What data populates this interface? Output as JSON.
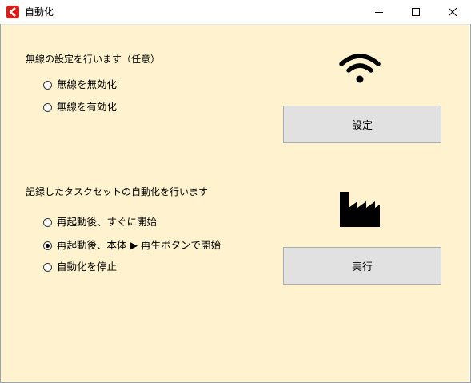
{
  "window": {
    "title": "自動化",
    "app_icon": "app-logo-icon",
    "controls": [
      "minimize-icon",
      "maximize-icon",
      "close-icon"
    ]
  },
  "wireless": {
    "heading": "無線の設定を行います（任意）",
    "icon": "wifi-icon",
    "options": [
      {
        "label": "無線を無効化",
        "checked": false
      },
      {
        "label": "無線を有効化",
        "checked": false
      }
    ],
    "button_label": "設定"
  },
  "automation": {
    "heading": "記録したタスクセットの自動化を行います",
    "icon": "factory-icon",
    "options": [
      {
        "label": "再起動後、すぐに開始",
        "checked": false
      },
      {
        "label": "再起動後、本体 ▶ 再生ボタンで開始",
        "checked": true
      },
      {
        "label": "自動化を停止",
        "checked": false
      }
    ],
    "button_label": "実行"
  },
  "colors": {
    "background": "#fff3cf",
    "button": "#e1e1e1",
    "app_icon_red": "#d91e18"
  }
}
